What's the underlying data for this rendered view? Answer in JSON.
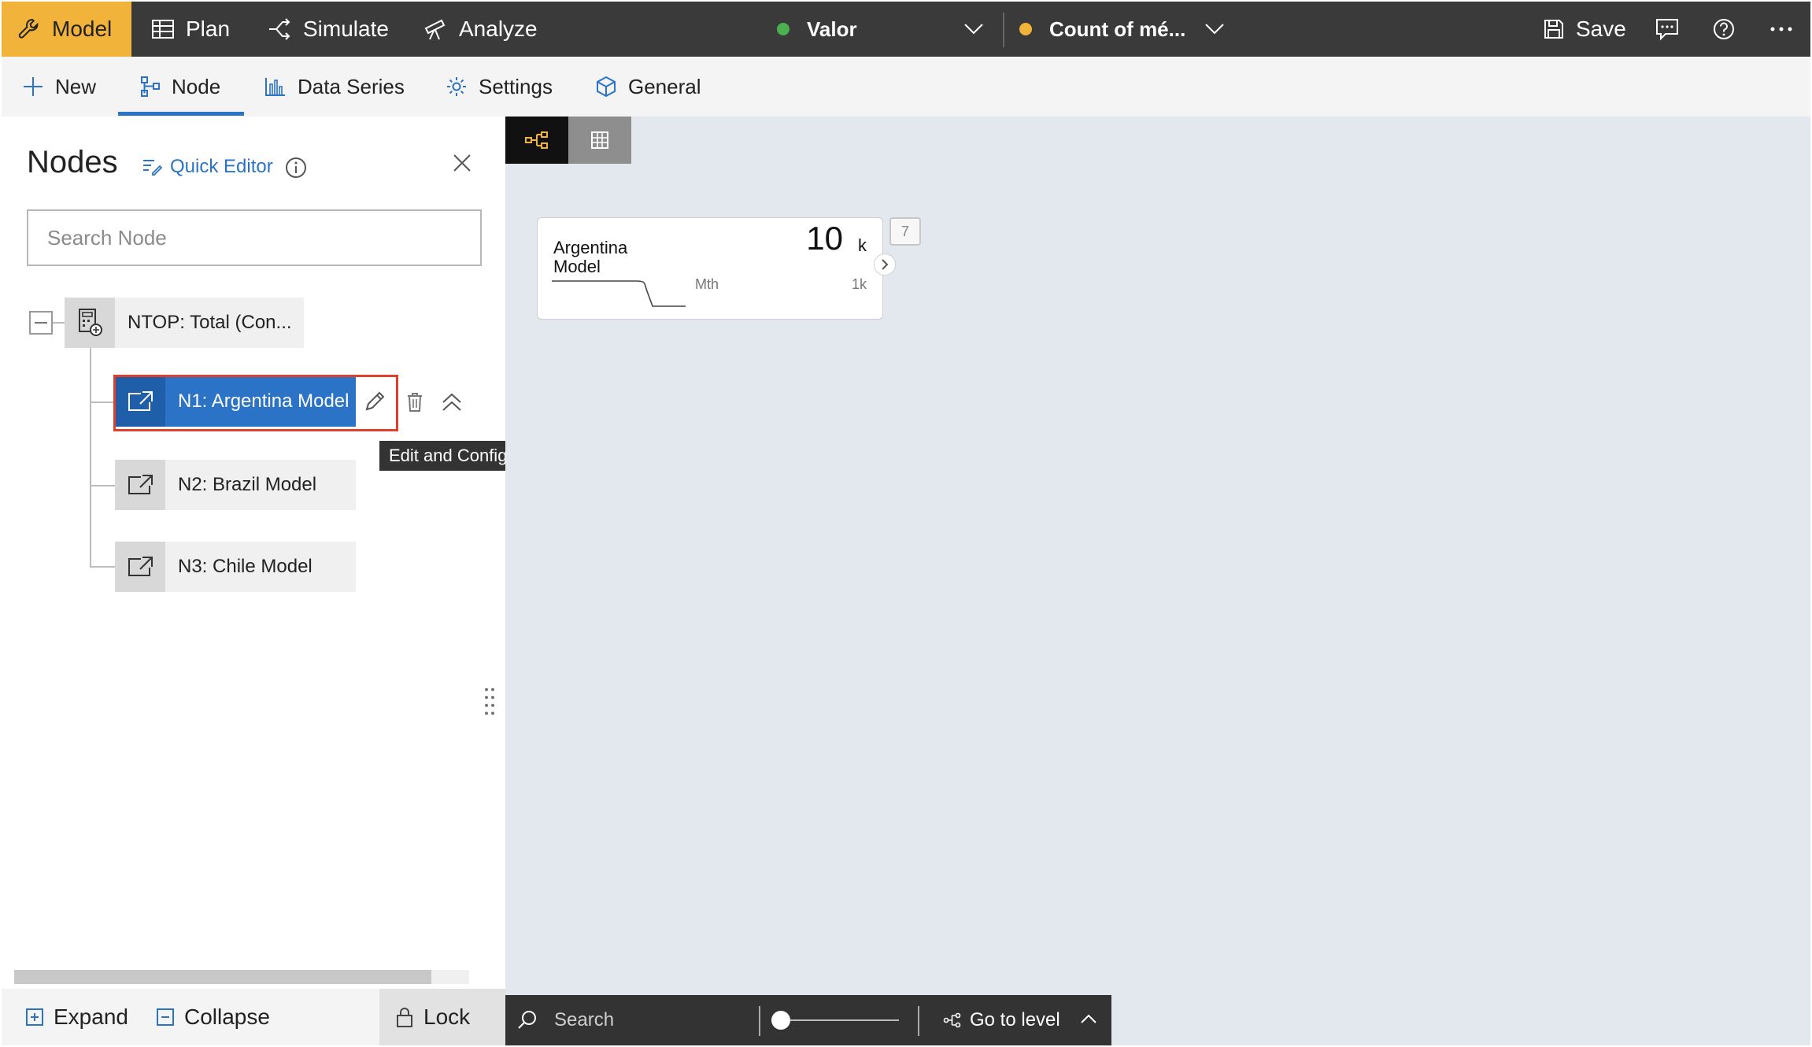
{
  "topbar": {
    "model_label": "Model",
    "plan_label": "Plan",
    "simulate_label": "Simulate",
    "analyze_label": "Analyze",
    "valor_label": "Valor",
    "valor_status_color": "#4caf50",
    "count_label": "Count of mé...",
    "count_status_color": "#f1b33a",
    "save_label": "Save",
    "active_color": "#f1b33a"
  },
  "toolbar": {
    "new_label": "New",
    "node_label": "Node",
    "data_series_label": "Data Series",
    "settings_label": "Settings",
    "general_label": "General",
    "accent_color": "#2b73c7"
  },
  "panel": {
    "title": "Nodes",
    "quick_editor_label": "Quick Editor",
    "search_placeholder": "Search Node",
    "root_node_label": "NTOP: Total (Con...",
    "children": [
      {
        "label": "N1: Argentina Model",
        "selected": true
      },
      {
        "label": "N2: Brazil Model",
        "selected": false
      },
      {
        "label": "N3: Chile Model",
        "selected": false
      }
    ],
    "tooltip": "Edit and Configure Node",
    "expand_label": "Expand",
    "collapse_label": "Collapse",
    "lock_label": "Lock"
  },
  "canvas": {
    "card": {
      "name": "Argentina Model",
      "value": "10",
      "unit": "k",
      "period": "Mth",
      "scale": "1k",
      "badge": "7"
    },
    "bottom": {
      "search_placeholder": "Search",
      "goto_label": "Go to level"
    }
  },
  "icons": {
    "model": "wrench-icon",
    "plan": "table-icon",
    "simulate": "branch-arrow-icon",
    "analyze": "telescope-icon",
    "save": "save-icon",
    "chat": "chat-icon",
    "help": "help-icon",
    "more": "more-icon"
  }
}
